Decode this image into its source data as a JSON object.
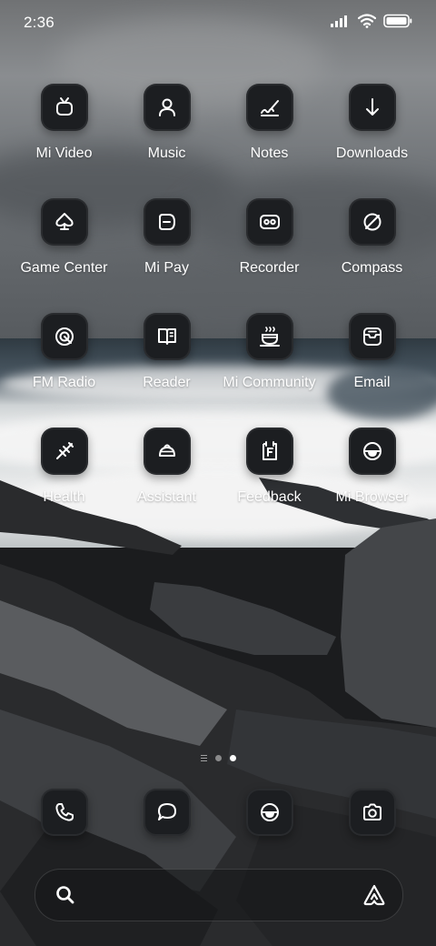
{
  "status_bar": {
    "time": "2:36"
  },
  "apps": [
    {
      "label": "Mi Video",
      "icon": "tv-icon"
    },
    {
      "label": "Music",
      "icon": "person-icon"
    },
    {
      "label": "Notes",
      "icon": "pen-scribble-icon"
    },
    {
      "label": "Downloads",
      "icon": "arrow-down-icon"
    },
    {
      "label": "Game Center",
      "icon": "spade-icon"
    },
    {
      "label": "Mi Pay",
      "icon": "wallet-icon"
    },
    {
      "label": "Recorder",
      "icon": "cassette-icon"
    },
    {
      "label": "Compass",
      "icon": "compass-icon"
    },
    {
      "label": "FM Radio",
      "icon": "radio-icon"
    },
    {
      "label": "Reader",
      "icon": "book-icon"
    },
    {
      "label": "Mi Community",
      "icon": "cup-icon"
    },
    {
      "label": "Email",
      "icon": "mailbox-icon"
    },
    {
      "label": "Health",
      "icon": "health-icon"
    },
    {
      "label": "Assistant",
      "icon": "cloud-hill-icon"
    },
    {
      "label": "Feedback",
      "icon": "clipboard-f-icon"
    },
    {
      "label": "Mi Browser",
      "icon": "globe-icon"
    }
  ],
  "page_indicator": {
    "pages": 2,
    "current": 2
  },
  "dock": [
    {
      "name": "phone",
      "icon": "phone-icon"
    },
    {
      "name": "messages",
      "icon": "chat-bubble-icon"
    },
    {
      "name": "browser",
      "icon": "globe-icon"
    },
    {
      "name": "camera",
      "icon": "camera-icon"
    }
  ],
  "search_bar": {
    "left_icon": "search-icon",
    "right_icon": "assistant-icon"
  }
}
